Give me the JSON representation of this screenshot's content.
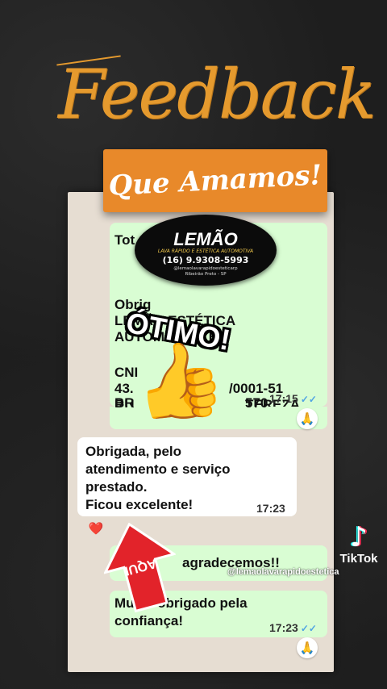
{
  "header": {
    "title": "Feedback",
    "banner": "Que Amamos!"
  },
  "logo": {
    "brand": "LEMÃO",
    "tagline": "LAVA RÁPIDO E ESTÉTICA AUTOMOTIVA",
    "phone": "(16) 9.9308-5993",
    "instagram": "@lemaolavarapidoesteticarp",
    "city": "Ribeirão Preto - SP"
  },
  "overlay": {
    "stamp": "ÓTIMO!",
    "thumb_icon": "thumbs-up-icon",
    "arrow_text": "AQUI"
  },
  "messages": [
    {
      "direction": "out",
      "lines": [
        "Tot",
        "Obrig",
        "LEMÃO ESTÉTICA",
        "AUTOMOTIVA E",
        "",
        "CNI",
        "43.",
        "/0001-51",
        "RU",
        "TEREZA",
        "BR",
        "570"
      ],
      "time": "17:15",
      "reaction": "🙏"
    },
    {
      "direction": "in",
      "lines": [
        "Obrigada, pelo",
        "atendimento e serviço",
        "prestado.",
        "Ficou excelente!"
      ],
      "time": "17:23",
      "reaction": "❤️"
    },
    {
      "direction": "out",
      "lines": [
        "agradecemos!!"
      ],
      "time": "",
      "reaction": ""
    },
    {
      "direction": "out",
      "lines": [
        "Mu",
        "o obrigado pela",
        "confiança!"
      ],
      "time": "17:23",
      "reaction": "🙏"
    }
  ],
  "watermark": {
    "app": "TikTok",
    "handle": "@lemaolavarapidoestetica"
  },
  "colors": {
    "accent": "#e8892a",
    "title": "#e59a2e",
    "bubble_out": "#d9fdd3",
    "chat_bg": "#e6ddd2",
    "read_tick": "#4fa3e3"
  }
}
